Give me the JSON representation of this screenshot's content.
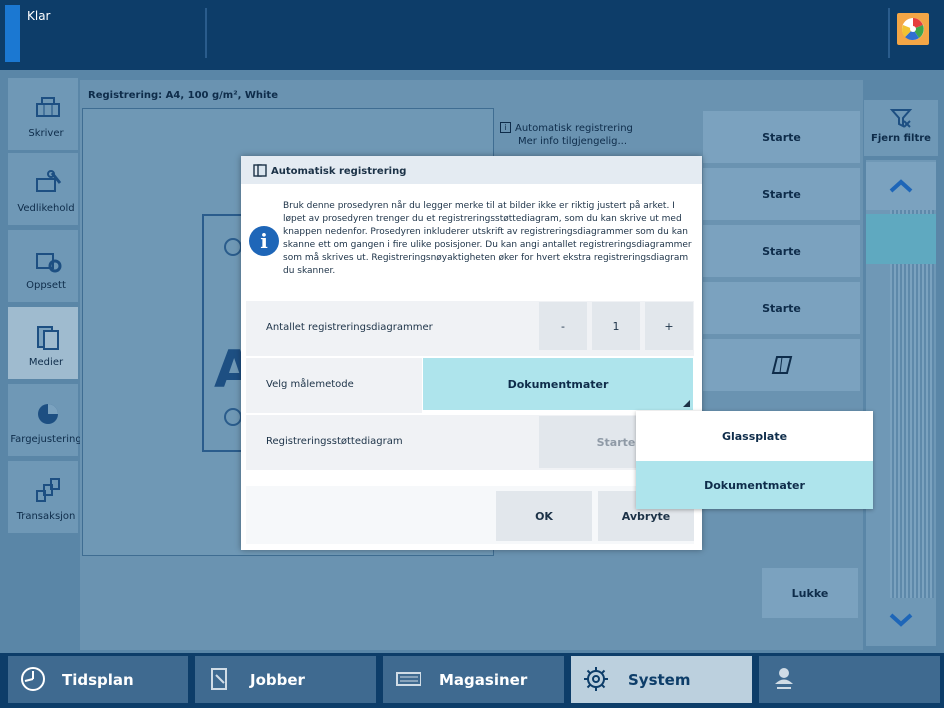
{
  "topbar": {
    "status": "Klar"
  },
  "nav": {
    "items": [
      {
        "label": "Skriver",
        "icon": "printer-icon"
      },
      {
        "label": "Vedlikehold",
        "icon": "maintenance-icon"
      },
      {
        "label": "Oppsett",
        "icon": "setup-icon"
      },
      {
        "label": "Medier",
        "icon": "media-icon"
      },
      {
        "label": "Fargejustering",
        "icon": "color-adjust-icon"
      },
      {
        "label": "Transaksjon",
        "icon": "transaction-icon"
      }
    ]
  },
  "panel": {
    "title": "Registrering: A4, 100 g/m², White",
    "preview_letter": "A",
    "info_line1": "Automatisk registrering",
    "info_line2": "Mer info tilgjengelig...",
    "start_label": "Starte",
    "filter_label": "Fjern filtre",
    "close_label": "Lukke"
  },
  "dialog": {
    "title": "Automatisk registrering",
    "description": "Bruk denne prosedyren når du legger merke til at bilder ikke er riktig justert på arket. I løpet av prosedyren trenger du et registreringsstøttediagram, som du kan skrive ut med knappen nedenfor. Prosedyren inkluderer utskrift av registreringsdiagrammer som du kan skanne ett om gangen i fire ulike posisjoner. Du kan angi antallet registreringsdiagrammer som må skrives ut. Registreringsnøyaktigheten øker for hvert ekstra registreringsdiagram du skanner.",
    "count_label": "Antallet registreringsdiagrammer",
    "count_minus": "-",
    "count_value": "1",
    "count_plus": "+",
    "method_label": "Velg målemetode",
    "method_value": "Dokumentmater",
    "chart_label": "Registreringsstøttediagram",
    "chart_button": "Starte",
    "ok_label": "OK",
    "cancel_label": "Avbryte"
  },
  "dropdown": {
    "options": [
      "Glassplate",
      "Dokumentmater"
    ],
    "selected": "Dokumentmater"
  },
  "bottomnav": {
    "items": [
      {
        "label": "Tidsplan",
        "icon": "clock-icon"
      },
      {
        "label": "Jobber",
        "icon": "jobs-icon"
      },
      {
        "label": "Magasiner",
        "icon": "trays-icon"
      },
      {
        "label": "System",
        "icon": "gear-icon"
      },
      {
        "label": "",
        "icon": "user-key-icon"
      }
    ]
  }
}
